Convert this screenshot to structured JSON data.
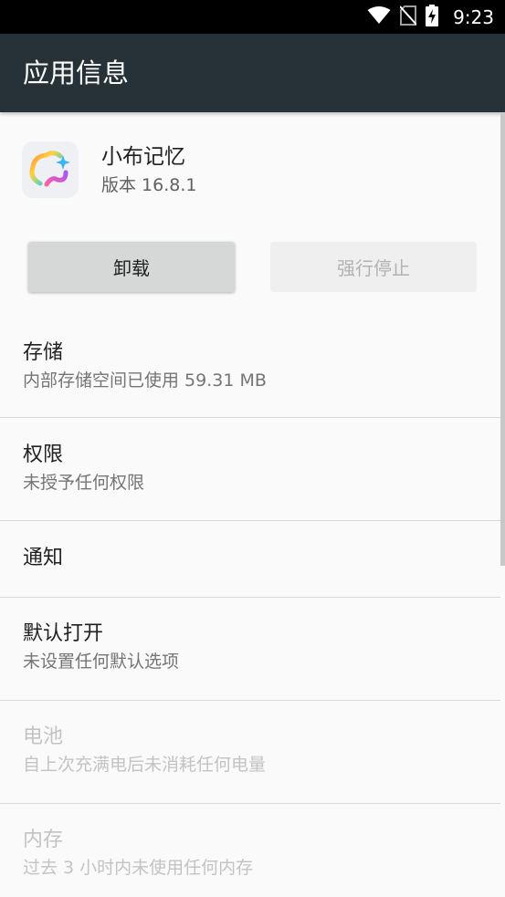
{
  "status_bar": {
    "time": "9:23",
    "icons": [
      "wifi-icon",
      "no-sim-icon",
      "battery-charging-icon"
    ]
  },
  "app_bar": {
    "title": "应用信息"
  },
  "app": {
    "name": "小布记忆",
    "version": "版本 16.8.1",
    "icon": "xiaobu-app-icon"
  },
  "buttons": {
    "uninstall": "卸载",
    "force_stop": "强行停止"
  },
  "items": [
    {
      "title": "存储",
      "summary": "内部存储空间已使用 59.31 MB",
      "enabled": true
    },
    {
      "title": "权限",
      "summary": "未授予任何权限",
      "enabled": true
    },
    {
      "title": "通知",
      "summary": "",
      "enabled": true
    },
    {
      "title": "默认打开",
      "summary": "未设置任何默认选项",
      "enabled": true
    },
    {
      "title": "电池",
      "summary": "自上次充满电后未消耗任何电量",
      "enabled": false
    },
    {
      "title": "内存",
      "summary": "过去 3 小时内未使用任何内存",
      "enabled": false
    }
  ],
  "colors": {
    "app_bar": "#263238",
    "status_bar": "#000000",
    "background": "#fafafa",
    "divider": "#d8d8d8"
  }
}
